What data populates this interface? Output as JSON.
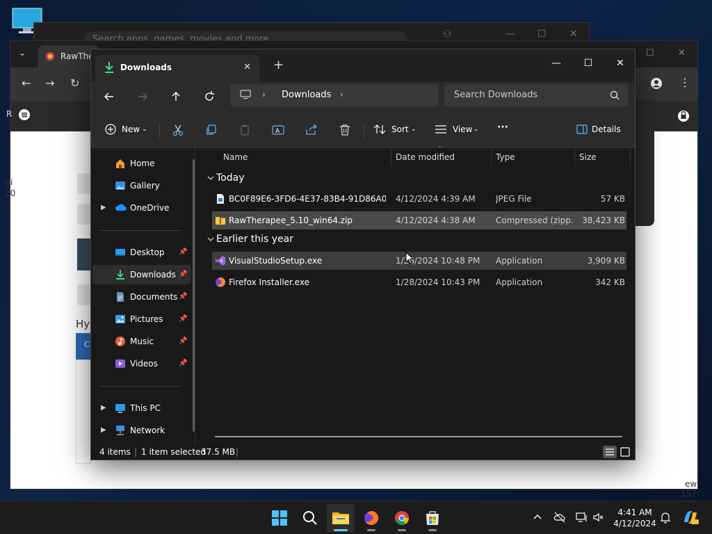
{
  "background": {
    "store_search_placeholder": "Search apps, games, movies and more",
    "chrome_tab_title": "RawThe",
    "peek_texts": [
      "R",
      "Vi",
      "20",
      "Hy",
      "C",
      "ew",
      "157"
    ]
  },
  "explorer": {
    "tab_title": "Downloads",
    "new_tab_symbol": "+",
    "address": {
      "crumb": "Downloads"
    },
    "search_placeholder": "Search Downloads",
    "commands": {
      "new": "New",
      "sort": "Sort",
      "view": "View",
      "more": "···",
      "details": "Details"
    },
    "sidebar": {
      "items": [
        {
          "label": "Home",
          "icon": "home-icon",
          "pinned": false
        },
        {
          "label": "Gallery",
          "icon": "gallery-icon",
          "pinned": false
        },
        {
          "label": "OneDrive",
          "icon": "cloud-icon",
          "pinned": false
        },
        {
          "label": "Desktop",
          "icon": "desktop-icon",
          "pinned": true
        },
        {
          "label": "Downloads",
          "icon": "download-icon",
          "pinned": true
        },
        {
          "label": "Documents",
          "icon": "document-icon",
          "pinned": true
        },
        {
          "label": "Pictures",
          "icon": "pictures-icon",
          "pinned": true
        },
        {
          "label": "Music",
          "icon": "music-icon",
          "pinned": true
        },
        {
          "label": "Videos",
          "icon": "video-icon",
          "pinned": true
        },
        {
          "label": "This PC",
          "icon": "computer-icon",
          "pinned": false
        },
        {
          "label": "Network",
          "icon": "network-icon",
          "pinned": false
        }
      ]
    },
    "columns": {
      "name": "Name",
      "date": "Date modified",
      "type": "Type",
      "size": "Size"
    },
    "groups": [
      {
        "label": "Today",
        "files": [
          {
            "name": "BC0F89E6-3FD6-4E37-83B4-91D86A0D57...",
            "date": "4/12/2024 4:39 AM",
            "type": "JPEG File",
            "size": "57 KB",
            "icon": "image-file-icon",
            "state": ""
          },
          {
            "name": "RawTherapee_5.10_win64.zip",
            "date": "4/12/2024 4:38 AM",
            "type": "Compressed (zipp...",
            "size": "38,423 KB",
            "icon": "zip-folder-icon",
            "state": "selected"
          }
        ]
      },
      {
        "label": "Earlier this year",
        "files": [
          {
            "name": "VisualStudioSetup.exe",
            "date": "1/28/2024 10:48 PM",
            "type": "Application",
            "size": "3,909 KB",
            "icon": "visual-studio-icon",
            "state": "hover"
          },
          {
            "name": "Firefox Installer.exe",
            "date": "1/28/2024 10:43 PM",
            "type": "Application",
            "size": "342 KB",
            "icon": "firefox-icon",
            "state": ""
          }
        ]
      }
    ],
    "status": {
      "count": "4 items",
      "selected": "1 item selected",
      "size": "37.5 MB"
    }
  },
  "taskbar": {
    "clock_time": "4:41 AM",
    "clock_date": "4/12/2024"
  }
}
